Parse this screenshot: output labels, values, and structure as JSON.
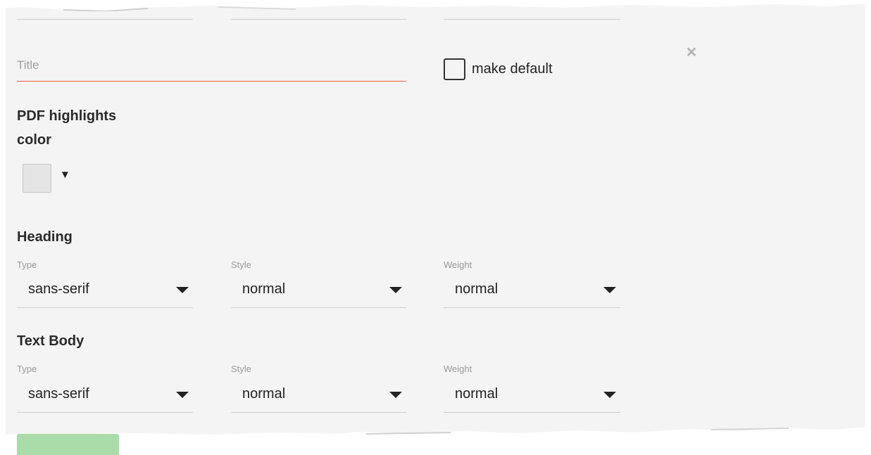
{
  "dialog": {
    "title_field": {
      "placeholder": "Title",
      "value": ""
    },
    "make_default_label": "make default",
    "close_symbol": "✕"
  },
  "pdf_highlights": {
    "label_line1": "PDF highlights",
    "label_line2": "color",
    "swatch_color": "#e5e5e5",
    "caret": "▼"
  },
  "heading": {
    "title": "Heading",
    "fields": [
      {
        "label": "Type",
        "value": "sans-serif"
      },
      {
        "label": "Style",
        "value": "normal"
      },
      {
        "label": "Weight",
        "value": "normal"
      }
    ]
  },
  "text_body": {
    "title": "Text Body",
    "fields": [
      {
        "label": "Type",
        "value": "sans-serif"
      },
      {
        "label": "Style",
        "value": "normal"
      },
      {
        "label": "Weight",
        "value": "normal"
      }
    ]
  },
  "colors": {
    "accent_underline": "#e8594a",
    "save_button": "#a9dca9"
  },
  "icons": {
    "close": "close-icon",
    "dropdown": "chevron-down-icon"
  }
}
